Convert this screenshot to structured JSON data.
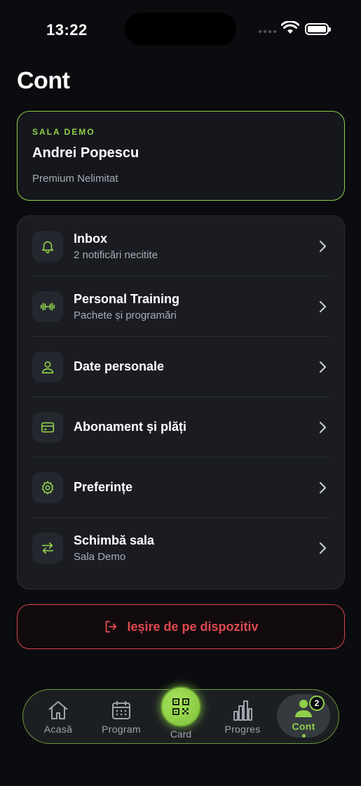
{
  "status_bar": {
    "time": "13:22"
  },
  "page": {
    "title": "Cont"
  },
  "profile": {
    "gym": "SALA DEMO",
    "name": "Andrei Popescu",
    "plan": "Premium Nelimitat"
  },
  "menu": {
    "items": [
      {
        "label": "Inbox",
        "subtitle": "2 notificări necitite",
        "icon": "bell-icon"
      },
      {
        "label": "Personal Training",
        "subtitle": "Pachete și programări",
        "icon": "dumbbell-icon"
      },
      {
        "label": "Date personale",
        "subtitle": "",
        "icon": "user-icon"
      },
      {
        "label": "Abonament și plăți",
        "subtitle": "",
        "icon": "credit-card-icon"
      },
      {
        "label": "Preferințe",
        "subtitle": "",
        "icon": "gear-icon"
      },
      {
        "label": "Schimbă sala",
        "subtitle": "Sala Demo",
        "icon": "swap-icon"
      }
    ]
  },
  "logout": {
    "label": "Ieșire de pe dispozitiv",
    "icon": "logout-icon"
  },
  "nav": {
    "home": "Acasă",
    "program": "Program",
    "card": "Card",
    "progress": "Progres",
    "account": "Cont",
    "account_badge": "2",
    "active": "account"
  },
  "colors": {
    "accent": "#8fcf4a",
    "danger": "#e04a50",
    "background": "#0b0c0f",
    "card": "#1a1c22"
  }
}
